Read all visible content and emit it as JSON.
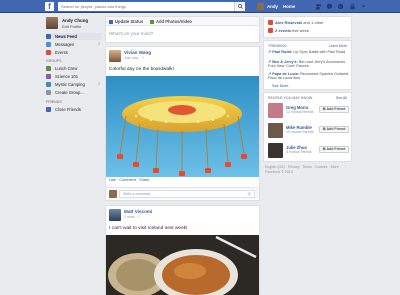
{
  "topbar": {
    "logo": "f",
    "search_placeholder": "Search for people, places and things",
    "user_name": "Andy",
    "home_label": "Home"
  },
  "profile": {
    "name": "Andy Chung",
    "edit_label": "Edit Profile"
  },
  "nav": {
    "items": [
      {
        "label": "News Feed",
        "count": "",
        "color": "#4267b2"
      },
      {
        "label": "Messages",
        "count": "2",
        "color": "#4a90d9"
      },
      {
        "label": "Events",
        "count": "",
        "color": "#e04a3a"
      }
    ],
    "groups_header": "GROUPS",
    "groups": [
      {
        "label": "Lunch Crew",
        "count": "",
        "color": "#5b8f3a"
      },
      {
        "label": "Science 101",
        "count": "",
        "color": "#8a5bb0"
      },
      {
        "label": "Mystic Camping",
        "count": "2",
        "color": "#3b8fc0"
      },
      {
        "label": "Create Group...",
        "count": "",
        "color": "#90949c"
      }
    ],
    "friends_header": "FRIENDS",
    "friends": [
      {
        "label": "Close Friends",
        "count": "",
        "color": "#4267b2"
      }
    ]
  },
  "composer": {
    "tab_status": "Update Status",
    "tab_photo": "Add Photos/Video",
    "placeholder": "What's on your mind?"
  },
  "posts": [
    {
      "author": "Vivian Wang",
      "meta": "Just now · ⚐",
      "text": "Colorful day on the boardwalk!",
      "actions": "Like · Comment · Share",
      "comment_placeholder": "Write a comment...",
      "camera_icon": "◎"
    },
    {
      "author": "Matt Viscomi",
      "meta": "2 mins · ⚐",
      "text": "I can't wait to visit Iceland next week!"
    }
  ],
  "notifications": {
    "row1_name": "Alex Ristevski",
    "row1_rest": "and 1 other",
    "row2": "2 events",
    "row2_rest": "this week"
  },
  "trending": {
    "header": "TRENDING",
    "learn_more": "Learn More",
    "items": [
      {
        "name": "Paul Rudd:",
        "text": "Lip Sync Battle with Paul Rudd"
      },
      {
        "name": "Ben & Jerry's:",
        "text": "Ben and Jerry's Announces Four New 'Core' Flavors"
      },
      {
        "name": "Papa de Lucia:",
        "text": "Renowned Spanish Guitarist Paco de Lucia dies"
      }
    ],
    "see_more": "See More"
  },
  "pymk": {
    "header": "PEOPLE YOU MAY KNOW",
    "see_all": "See All",
    "people": [
      {
        "name": "Greg Marra",
        "mutual": "12 mutual friends",
        "color": "#c47a8a"
      },
      {
        "name": "Mike Rumble",
        "mutual": "19 mutual friends",
        "color": "#6b5a4a"
      },
      {
        "name": "Julie Zhuo",
        "mutual": "5 mutual friends",
        "color": "#3a3330"
      }
    ],
    "add_label": "Add Friend"
  },
  "footer": {
    "line1": "English (US) · Privacy · Terms · Cookies · More ·",
    "line2": "Facebook © 2014"
  }
}
